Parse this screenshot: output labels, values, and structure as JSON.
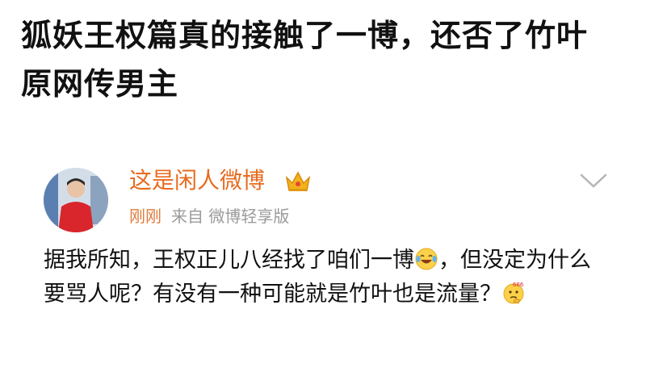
{
  "headline": {
    "line1": "狐妖王权篇真的接触了一博，还否了竹叶",
    "line2": "原网传男主"
  },
  "post": {
    "username": "这是闲人微博",
    "time": "刚刚",
    "source": "来自 微博轻享版",
    "body": {
      "part1": "据我所知，王权正儿八经找了咱们一博",
      "part2": "，但没定为什么要骂人呢？有没有一种可能就是竹叶也是流量？"
    },
    "icons": {
      "verified": "crown-icon",
      "more": "chevron-down-icon",
      "emoji1": "laugh-cry-emoji",
      "emoji2": "thinking-666-emoji"
    },
    "colors": {
      "username": "#e86b1f",
      "time": "#e07a3a",
      "meta": "#9a9a9a"
    }
  }
}
